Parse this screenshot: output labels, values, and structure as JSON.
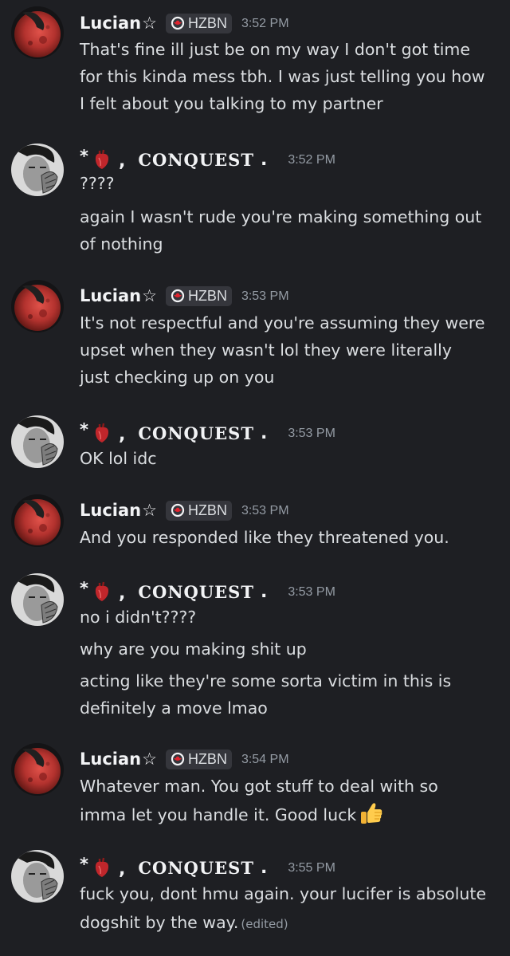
{
  "theme": {
    "background": "#1e1f23",
    "text": "#dbdee1",
    "username": "#f2f3f5",
    "muted": "#949ba4",
    "tag_background": "#35363c"
  },
  "users": {
    "lucian": {
      "name": "Lucian",
      "star": "☆",
      "tag": "HZBN",
      "avatar_icon": "red-moon-avatar"
    },
    "conquest": {
      "prefix": "*",
      "heart_icon": "anatomical-heart-icon",
      "comma": ",",
      "name": "CONQUEST",
      "dot": ".",
      "avatar_icon": "grayscale-face-avatar"
    }
  },
  "messages": [
    {
      "author": "lucian",
      "time": "3:52 PM",
      "lines": [
        "That's fine ill just be on my way I don't got time",
        "for this kinda mess tbh. I was just telling you how",
        "I felt about you talking to my partner"
      ]
    },
    {
      "author": "conquest",
      "time": "3:52 PM",
      "lines": [
        "????",
        "again I wasn't rude you're making something out",
        "of nothing"
      ]
    },
    {
      "author": "lucian",
      "time": "3:53 PM",
      "lines": [
        "It's not respectful and you're assuming they were",
        "upset when they wasn't lol they were literally",
        "just checking up on you"
      ]
    },
    {
      "author": "conquest",
      "time": "3:53 PM",
      "lines": [
        "OK lol idc"
      ]
    },
    {
      "author": "lucian",
      "time": "3:53 PM",
      "lines": [
        "And you responded like they threatened you."
      ]
    },
    {
      "author": "conquest",
      "time": "3:53 PM",
      "lines": [
        "no i didn't????",
        "why are you making shit up",
        "acting like they're some sorta victim in this is",
        "definitely a move lmao"
      ]
    },
    {
      "author": "lucian",
      "time": "3:54 PM",
      "lines": [
        "Whatever man.  You got stuff to deal with so",
        "imma let you handle it. Good luck"
      ],
      "trailing_emoji": "thumbs-up-emoji"
    },
    {
      "author": "conquest",
      "time": "3:55 PM",
      "lines": [
        "fuck you, dont hmu again. your lucifer is absolute",
        "dogshit by the way."
      ],
      "edited_label": "(edited)"
    }
  ]
}
